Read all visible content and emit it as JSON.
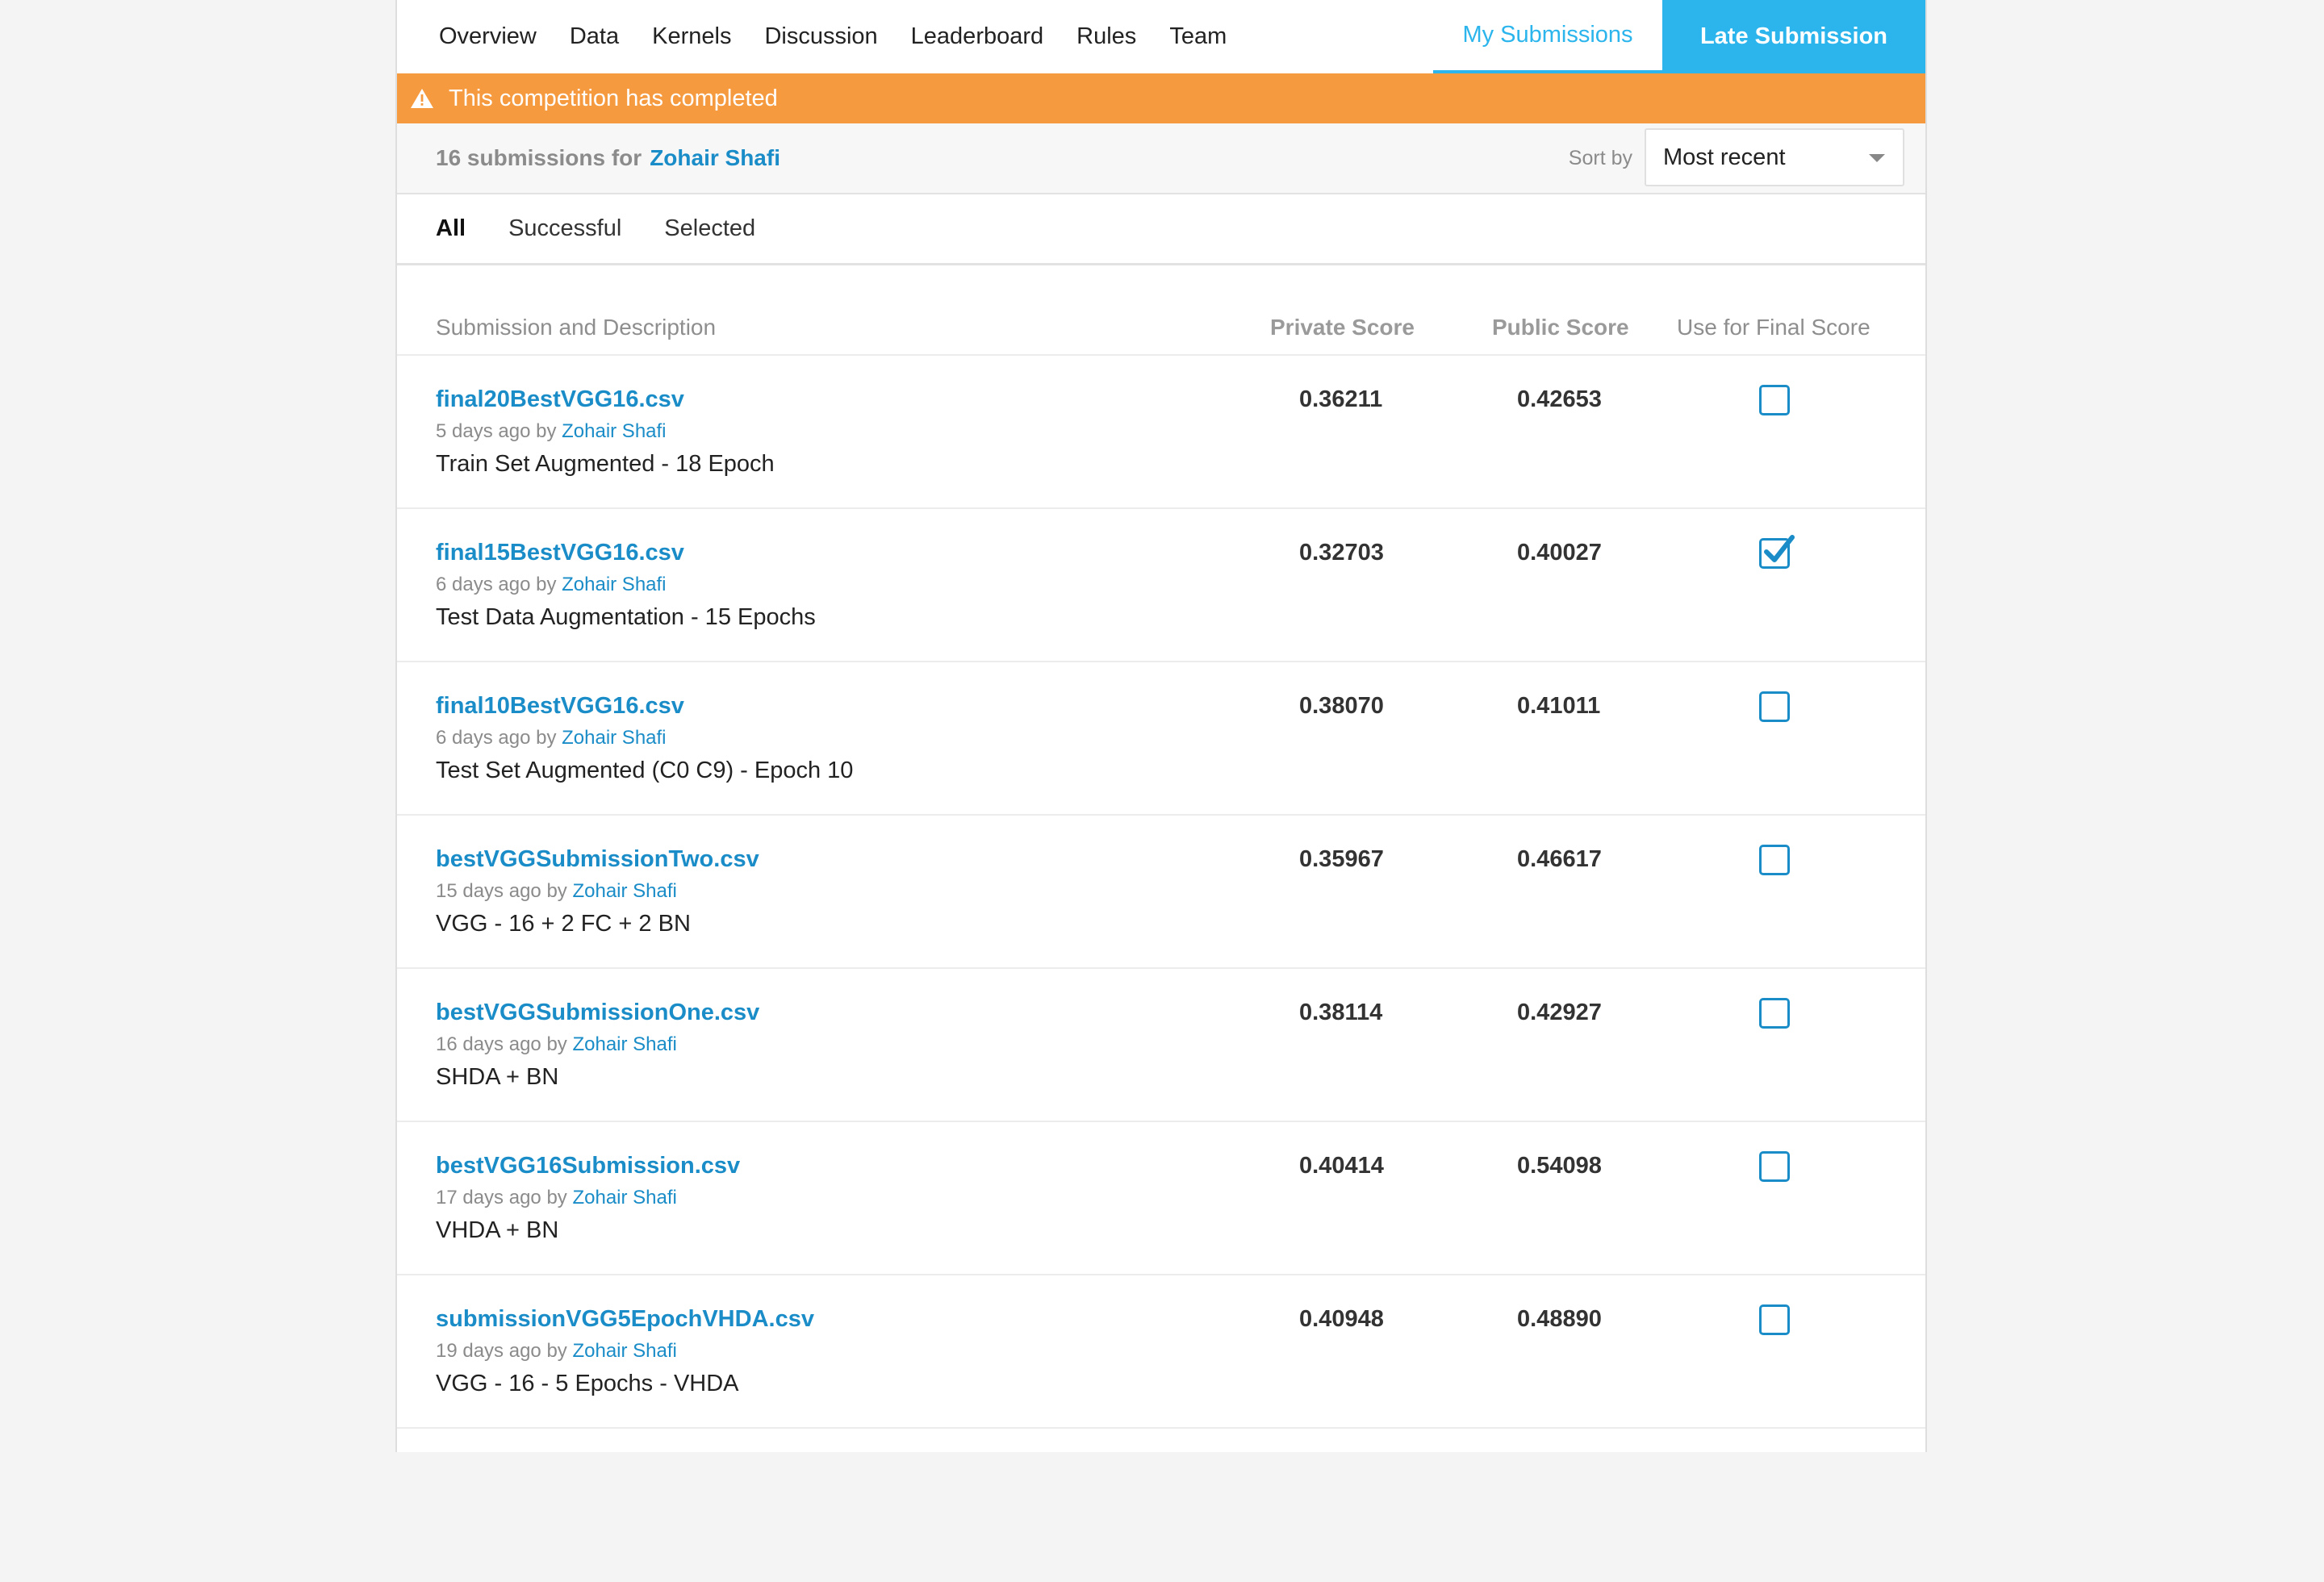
{
  "nav": {
    "links": [
      "Overview",
      "Data",
      "Kernels",
      "Discussion",
      "Leaderboard",
      "Rules",
      "Team"
    ],
    "my_submissions": "My Submissions",
    "late_submission": "Late Submission"
  },
  "alert": {
    "text": "This competition has completed",
    "icon": "warning-icon"
  },
  "submissions_bar": {
    "count_text": "16 submissions for",
    "user": "Zohair Shafi",
    "sort_label": "Sort by",
    "sort_value": "Most recent"
  },
  "filters": [
    "All",
    "Successful",
    "Selected"
  ],
  "table": {
    "headers": {
      "description": "Submission and Description",
      "private": "Private Score",
      "public": "Public Score",
      "use": "Use for Final Score"
    },
    "rows": [
      {
        "file": "final20BestVGG16.csv",
        "age": "5 days ago by",
        "user": "Zohair Shafi",
        "description": "Train Set Augmented - 18 Epoch",
        "private": "0.36211",
        "public": "0.42653",
        "selected": false
      },
      {
        "file": "final15BestVGG16.csv",
        "age": "6 days ago by",
        "user": "Zohair Shafi",
        "description": "Test Data Augmentation - 15 Epochs",
        "private": "0.32703",
        "public": "0.40027",
        "selected": true
      },
      {
        "file": "final10BestVGG16.csv",
        "age": "6 days ago by",
        "user": "Zohair Shafi",
        "description": "Test Set Augmented (C0 C9) - Epoch 10",
        "private": "0.38070",
        "public": "0.41011",
        "selected": false
      },
      {
        "file": "bestVGGSubmissionTwo.csv",
        "age": "15 days ago by",
        "user": "Zohair Shafi",
        "description": "VGG - 16 + 2 FC + 2 BN",
        "private": "0.35967",
        "public": "0.46617",
        "selected": false
      },
      {
        "file": "bestVGGSubmissionOne.csv",
        "age": "16 days ago by",
        "user": "Zohair Shafi",
        "description": "SHDA + BN",
        "private": "0.38114",
        "public": "0.42927",
        "selected": false
      },
      {
        "file": "bestVGG16Submission.csv",
        "age": "17 days ago by",
        "user": "Zohair Shafi",
        "description": "VHDA + BN",
        "private": "0.40414",
        "public": "0.54098",
        "selected": false
      },
      {
        "file": "submissionVGG5EpochVHDA.csv",
        "age": "19 days ago by",
        "user": "Zohair Shafi",
        "description": "VGG - 16 - 5 Epochs - VHDA",
        "private": "0.40948",
        "public": "0.48890",
        "selected": false
      }
    ]
  },
  "colors": {
    "accent": "#2bb5ec",
    "link": "#1a8cc7",
    "alert": "#f59a3f"
  }
}
